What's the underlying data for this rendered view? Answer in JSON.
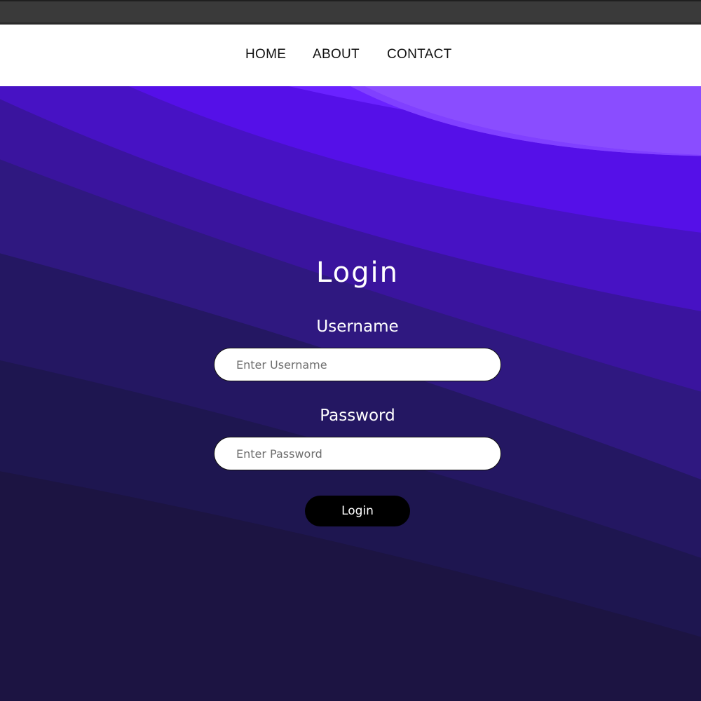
{
  "nav": {
    "items": [
      {
        "label": "HOME"
      },
      {
        "label": "ABOUT"
      },
      {
        "label": "CONTACT"
      }
    ]
  },
  "login": {
    "title": "Login",
    "username_label": "Username",
    "username_placeholder": "Enter Username",
    "password_label": "Password",
    "password_placeholder": "Enter Password",
    "submit_label": "Login"
  },
  "colors": {
    "navbar_bg": "#ffffff",
    "browser_bar": "#3a3a3a",
    "wave_light": "#8a4dff",
    "wave_mid": "#5a12e8",
    "wave_dark": "#1b1440",
    "button_bg": "#000000",
    "text_on_hero": "#ffffff"
  }
}
